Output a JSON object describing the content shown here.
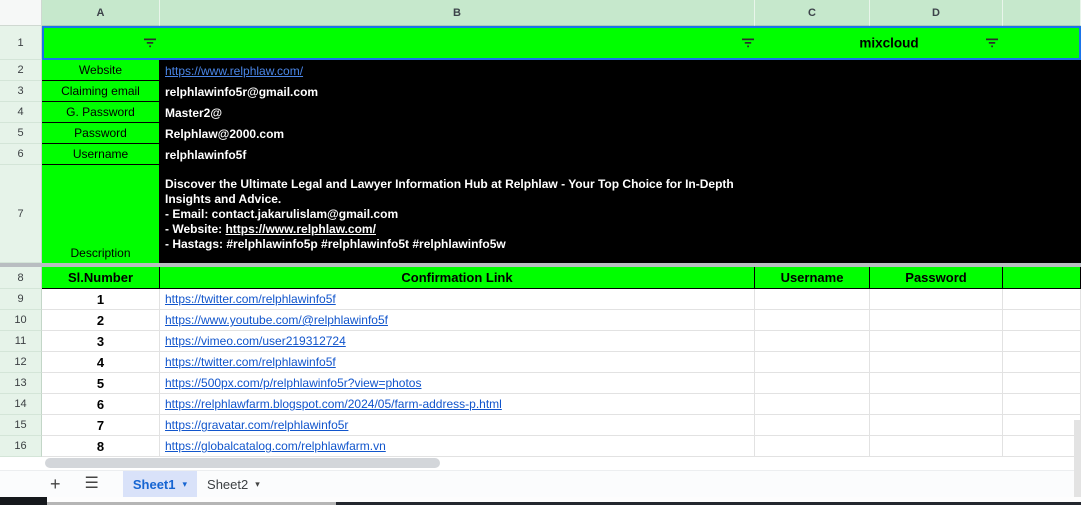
{
  "header_row": {
    "columns": [
      "A",
      "B",
      "C",
      "D",
      ""
    ]
  },
  "filter_bar": {
    "row": "1",
    "title": "mixcloud"
  },
  "website_row": {
    "row": "2",
    "label": "Website",
    "link": "https://www.relphlaw.com/"
  },
  "info_rows": [
    {
      "row": "3",
      "label": "Claiming email",
      "value": "relphlawinfo5r@gmail.com"
    },
    {
      "row": "4",
      "label": "G. Password",
      "value": "Master2@"
    },
    {
      "row": "5",
      "label": "Password",
      "value": "Relphlaw@2000.com"
    },
    {
      "row": "6",
      "label": "Username",
      "value": "relphlawinfo5f"
    }
  ],
  "description_row": {
    "row": "7",
    "label": "Description",
    "line1": "Discover the Ultimate Legal and Lawyer Information Hub at Relphlaw - Your Top Choice for In-Depth",
    "line2": "Insights and Advice.",
    "line3": "- Email: contact.jakarulislam@gmail.com",
    "line4_prefix": "- Website:",
    "line4_link": "https://www.relphlaw.com/",
    "line5": "- Hastags: #relphlawinfo5p #relphlawinfo5t #relphlawinfo5w"
  },
  "links_table": {
    "header_row": "8",
    "headers": {
      "sl": "Sl.Number",
      "link": "Confirmation Link",
      "username": "Username",
      "password": "Password"
    },
    "rows": [
      {
        "row": "9",
        "sl": "1",
        "link": "https://twitter.com/relphlawinfo5f"
      },
      {
        "row": "10",
        "sl": "2",
        "link": "https://www.youtube.com/@relphlawinfo5f"
      },
      {
        "row": "11",
        "sl": "3",
        "link": "https://vimeo.com/user219312724"
      },
      {
        "row": "12",
        "sl": "4",
        "link": "https://twitter.com/relphlawinfo5f"
      },
      {
        "row": "13",
        "sl": "5",
        "link": "https://500px.com/p/relphlawinfo5r?view=photos"
      },
      {
        "row": "14",
        "sl": "6",
        "link": "https://relphlawfarm.blogspot.com/2024/05/farm-address-p.html"
      },
      {
        "row": "15",
        "sl": "7",
        "link": "https://gravatar.com/relphlawinfo5r"
      },
      {
        "row": "16",
        "sl": "8",
        "link": "https://globalcatalog.com/relphlawfarm.vn"
      }
    ]
  },
  "tab_bar": {
    "add_label": "+",
    "all_sheets_label": "☰",
    "sheet1": "Sheet1",
    "sheet2": "Sheet2",
    "arrow": "▾"
  },
  "colors": {
    "bright_green": "#00ff00",
    "header_green": "#c6e8cc",
    "row_header_green": "#e6f3e9",
    "selection_blue": "#1a73e8",
    "link_on_black": "#4a86e8",
    "link_on_white": "#1155cc",
    "active_tab_text": "#1665d2",
    "active_tab_bg": "#d9e2f9"
  }
}
